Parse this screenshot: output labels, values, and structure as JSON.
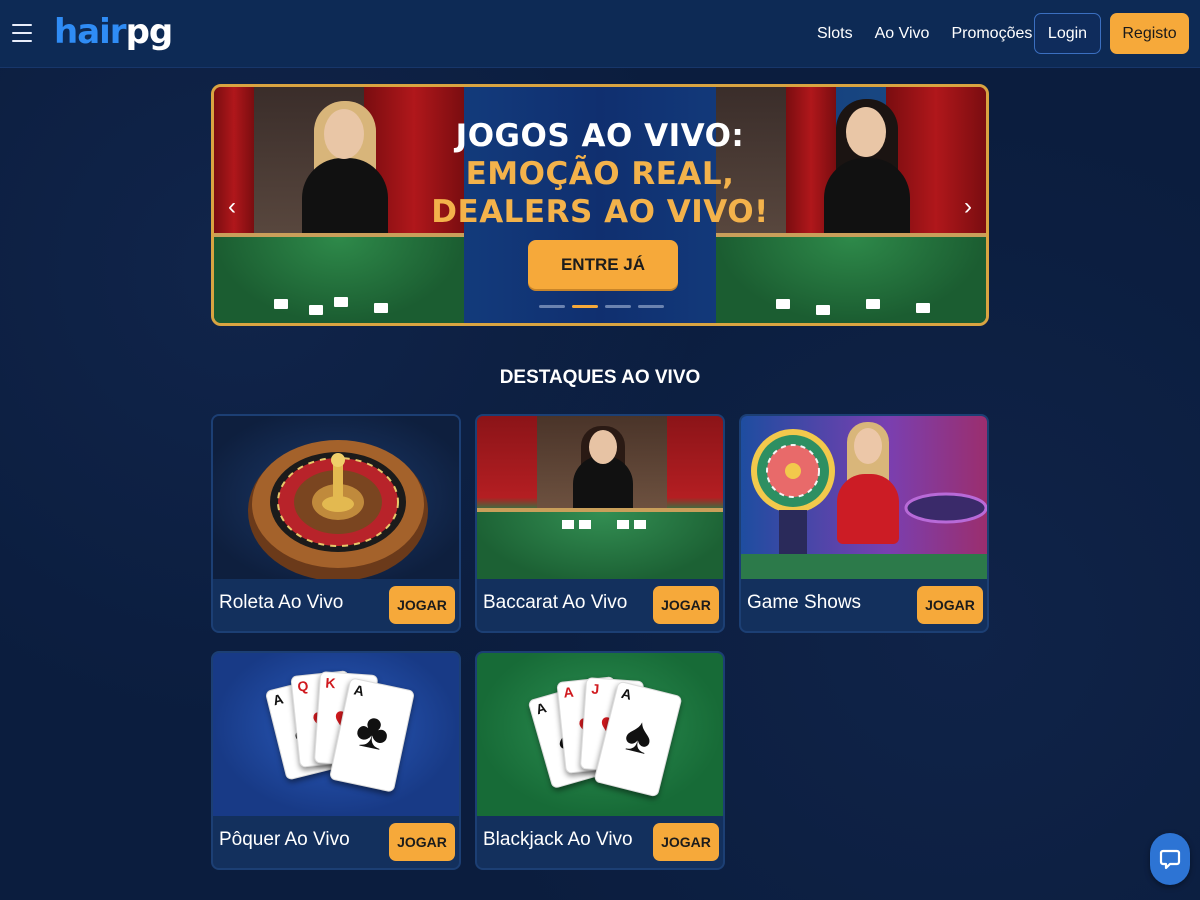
{
  "header": {
    "logo_part1": "hair",
    "logo_part2": "pg",
    "nav": [
      {
        "label": "Slots"
      },
      {
        "label": "Ao Vivo"
      },
      {
        "label": "Promoções"
      }
    ],
    "login_label": "Login",
    "register_label": "Registo",
    "menu_icon": "hamburger-icon"
  },
  "banner": {
    "line1": "JOGOS AO VIVO:",
    "line2": "EMOÇÃO REAL,",
    "line3": "DEALERS AO VIVO!",
    "cta_label": "ENTRE JÁ",
    "prev_icon": "chevron-left-icon",
    "next_icon": "chevron-right-icon",
    "slide_count": 4,
    "active_slide": 2,
    "border_color": "#d9a441",
    "accent_color": "#f6a93a"
  },
  "section": {
    "title": "DESTAQUES AO VIVO"
  },
  "games": [
    {
      "name": "Roleta Ao Vivo",
      "play_label": "JOGAR"
    },
    {
      "name": "Baccarat Ao Vivo",
      "play_label": "JOGAR"
    },
    {
      "name": "Game Shows",
      "play_label": "JOGAR"
    },
    {
      "name": "Pôquer Ao Vivo",
      "play_label": "JOGAR"
    },
    {
      "name": "Blackjack Ao Vivo",
      "play_label": "JOGAR"
    }
  ],
  "poker_cards": [
    {
      "rank": "A",
      "suit": "♠",
      "color": "blk"
    },
    {
      "rank": "Q",
      "suit": "♥",
      "color": "red"
    },
    {
      "rank": "K",
      "suit": "♥",
      "color": "red"
    },
    {
      "rank": "A",
      "suit": "♣",
      "color": "blk"
    }
  ],
  "blackjack_cards": [
    {
      "rank": "A",
      "suit": "♠",
      "color": "blk"
    },
    {
      "rank": "A",
      "suit": "♥",
      "color": "red"
    },
    {
      "rank": "J",
      "suit": "♥",
      "color": "red"
    },
    {
      "rank": "A",
      "suit": "♠",
      "color": "blk"
    }
  ],
  "chat": {
    "icon": "chat-bubble-icon"
  }
}
